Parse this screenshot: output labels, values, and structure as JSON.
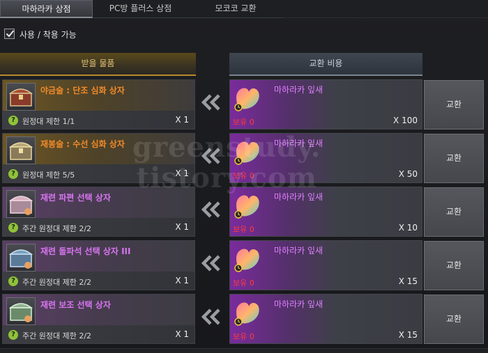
{
  "tabs": [
    {
      "label": "마하라카 상점",
      "active": true
    },
    {
      "label": "PC방 플러스 상점",
      "active": false
    },
    {
      "label": "모코코 교환",
      "active": false
    }
  ],
  "filter": {
    "label": "사용 / 착용 가능",
    "checked": true
  },
  "headers": {
    "receive": "받을 물품",
    "cost": "교환 비용"
  },
  "rows": [
    {
      "name": "야금술 : 단조 심화 상자",
      "grade": "legendary",
      "limit": "원정대 제한 1/1",
      "qty": "X 1",
      "cost_name": "마하라카 잎새",
      "owned": "보유 0",
      "cost_qty": "X 100",
      "button": "교환",
      "chest_icon": "red-chest-icon"
    },
    {
      "name": "재봉술 : 수선 심화 상자",
      "grade": "legendary",
      "limit": "원정대 제한 5/5",
      "qty": "X 1",
      "cost_name": "마하라카 잎새",
      "owned": "보유 0",
      "cost_qty": "X 50",
      "button": "교환",
      "chest_icon": "gold-chest-icon"
    },
    {
      "name": "재련 파편 선택 상자",
      "grade": "epic",
      "limit": "주간 원정대 제한 2/2",
      "qty": "X 1",
      "cost_name": "마하라카 잎새",
      "owned": "보유 0",
      "cost_qty": "X 10",
      "button": "교환",
      "chest_icon": "pink-chest-icon"
    },
    {
      "name": "재련 돌파석 선택 상자 III",
      "grade": "epic",
      "limit": "주간 원정대 제한 2/2",
      "qty": "X 1",
      "cost_name": "마하라카 잎새",
      "owned": "보유 0",
      "cost_qty": "X 15",
      "button": "교환",
      "chest_icon": "blue-chest-icon"
    },
    {
      "name": "재련 보조 선택 상자",
      "grade": "epic",
      "limit": "주간 원정대 제한 2/2",
      "qty": "X 1",
      "cost_name": "마하라카 잎새",
      "owned": "보유 0",
      "cost_qty": "X 15",
      "button": "교환",
      "chest_icon": "green-chest-icon"
    }
  ],
  "watermark": {
    "line1": "greenstudy.",
    "line2": "tistory.com"
  },
  "colors": {
    "legendary": "#f08a2a",
    "epic": "#d775f0",
    "owned_zero": "#ff3b3b",
    "check": "#8fc23a"
  }
}
